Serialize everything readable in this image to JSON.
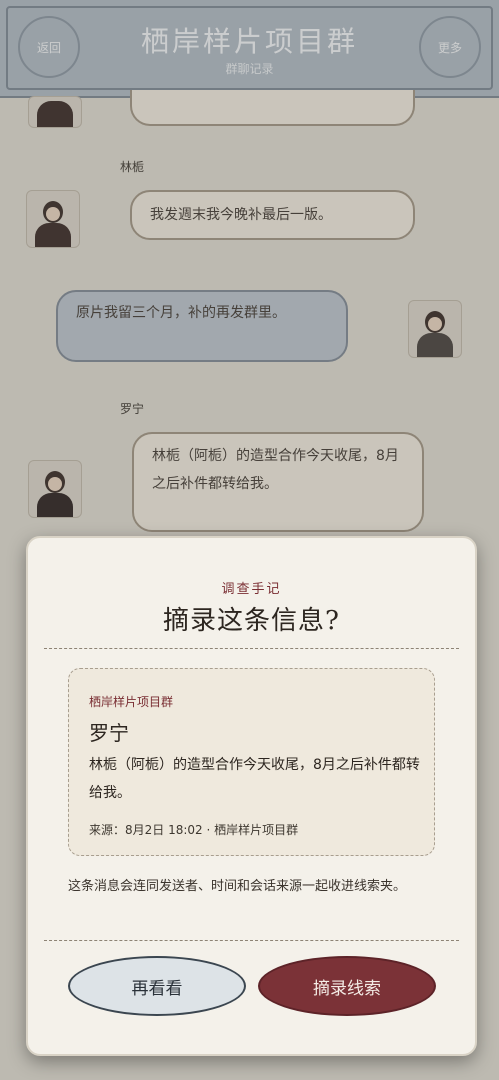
{
  "header": {
    "title": "栖岸样片项目群",
    "subtitle": "群聊记录",
    "left_button": "返回",
    "right_button": "更多"
  },
  "chat": {
    "messages": [
      {
        "sender": "林栀",
        "text": "我发週末我今晚补最后一版。"
      },
      {
        "sender": "我",
        "text": "原片我留三个月，补的再发群里。"
      },
      {
        "sender": "罗宁",
        "text": "林栀（阿栀）的造型合作今天收尾，8月之后补件都转给我。"
      }
    ]
  },
  "dialog": {
    "kicker": "调查手记",
    "title": "摘录这条信息?",
    "card": {
      "group": "栖岸样片项目群",
      "sender": "罗宁",
      "message": "林栀（阿栀）的造型合作今天收尾，8月之后补件都转给我。",
      "source": "来源：8月2日 18:02 · 栖岸样片项目群"
    },
    "note": "这条消息会连同发送者、时间和会话来源一起收进线索夹。",
    "cancel_label": "再看看",
    "confirm_label": "摘录线索"
  }
}
